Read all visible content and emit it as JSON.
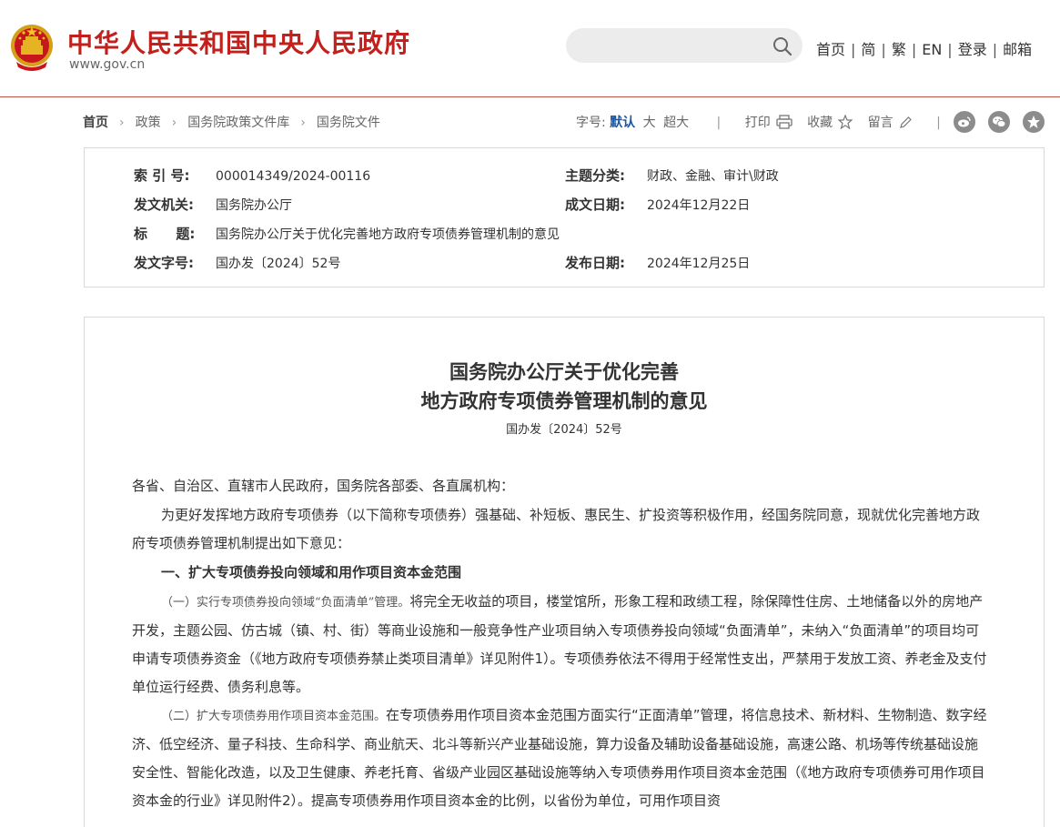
{
  "header": {
    "site_title": "中华人民共和国中央人民政府",
    "site_url": "www.gov.cn",
    "search_placeholder": "",
    "nav": [
      "首页",
      "简",
      "繁",
      "EN",
      "登录",
      "邮箱"
    ]
  },
  "breadcrumb": [
    "首页",
    "政策",
    "国务院政策文件库",
    "国务院文件"
  ],
  "tools": {
    "font_size_label": "字号:",
    "sizes": [
      "默认",
      "大",
      "超大"
    ],
    "print_label": "打印",
    "favorite_label": "收藏",
    "comment_label": "留言",
    "divider": "|"
  },
  "share_icons": [
    "weibo-icon",
    "wechat-icon",
    "star-icon"
  ],
  "meta": {
    "index_label": "索 引 号:",
    "index_value": "000014349/2024-00116",
    "topic_label": "主题分类:",
    "topic_value": "财政、金融、审计\\财政",
    "issuer_label": "发文机关:",
    "issuer_value": "国务院办公厅",
    "written_label": "成文日期:",
    "written_value": "2024年12月22日",
    "title_label": "标      题:",
    "title_value": "国务院办公厅关于优化完善地方政府专项债券管理机制的意见",
    "docno_label": "发文字号:",
    "docno_value": "国办发〔2024〕52号",
    "published_label": "发布日期:",
    "published_value": "2024年12月25日"
  },
  "document": {
    "title_line1": "国务院办公厅关于优化完善",
    "title_line2": "地方政府专项债券管理机制的意见",
    "doc_number": "国办发〔2024〕52号",
    "addressee": "各省、自治区、直辖市人民政府，国务院各部委、各直属机构：",
    "intro": "为更好发挥地方政府专项债券（以下简称专项债券）强基础、补短板、惠民生、扩投资等积极作用，经国务院同意，现就优化完善地方政府专项债券管理机制提出如下意见：",
    "section1": "一、扩大专项债券投向领域和用作项目资本金范围",
    "item1_head": "（一）实行专项债券投向领域“负面清单”管理。",
    "item1_body": "将完全无收益的项目，楼堂馆所，形象工程和政绩工程，除保障性住房、土地储备以外的房地产开发，主题公园、仿古城（镇、村、街）等商业设施和一般竞争性产业项目纳入专项债券投向领域“负面清单”，未纳入“负面清单”的项目均可申请专项债券资金（《地方政府专项债券禁止类项目清单》详见附件1）。专项债券依法不得用于经常性支出，严禁用于发放工资、养老金及支付单位运行经费、债务利息等。",
    "item2_head": "（二）扩大专项债券用作项目资本金范围。",
    "item2_body": "在专项债券用作项目资本金范围方面实行“正面清单”管理，将信息技术、新材料、生物制造、数字经济、低空经济、量子科技、生命科学、商业航天、北斗等新兴产业基础设施，算力设备及辅助设备基础设施，高速公路、机场等传统基础设施安全性、智能化改造，以及卫生健康、养老托育、省级产业园区基础设施等纳入专项债券用作项目资本金范围（《地方政府专项债券可用作项目资本金的行业》详见附件2）。提高专项债券用作项目资本金的比例，以省份为单位，可用作项目资"
  }
}
